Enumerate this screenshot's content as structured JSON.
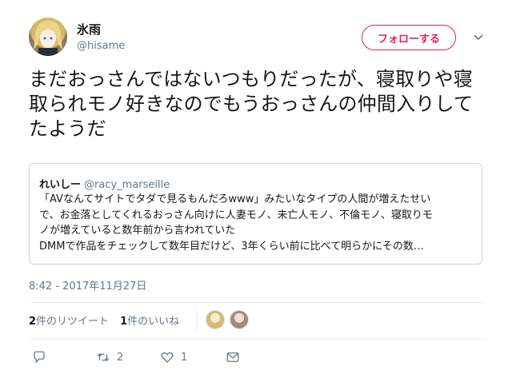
{
  "tweet": {
    "author_name": "氷雨",
    "author_handle": "@hisame",
    "follow_label": "フォローする",
    "text": "まだおっさんではないつもりだったが、寝取りや寝取られモノ好きなのでもうおっさんの仲間入りしてたようだ",
    "timestamp": "8:42 - 2017年11月27日",
    "accent_color": "#e0245e"
  },
  "quote": {
    "name": "れいしー",
    "handle": "@racy_marseille",
    "lines": [
      "「AVなんてサイトでタダで見るもんだろwww」みたいなタイプの人間が増えたせい",
      "で、お金落としてくれるおっさん向けに人妻モノ、未亡人モノ、不倫モノ、寝取りモ",
      "ノが増えていると数年前から言われていた",
      "DMMで作品をチェックして数年目だけど、3年くらい前に比べて明らかにその数…"
    ]
  },
  "stats": {
    "retweets_count": "2",
    "retweets_label": "件のリツイート",
    "likes_count": "1",
    "likes_label": "件のいいね"
  },
  "actions": {
    "reply_icon": "reply-icon",
    "retweet_icon": "retweet-icon",
    "retweet_count": "2",
    "like_icon": "heart-icon",
    "like_count": "1",
    "dm_icon": "envelope-icon"
  }
}
